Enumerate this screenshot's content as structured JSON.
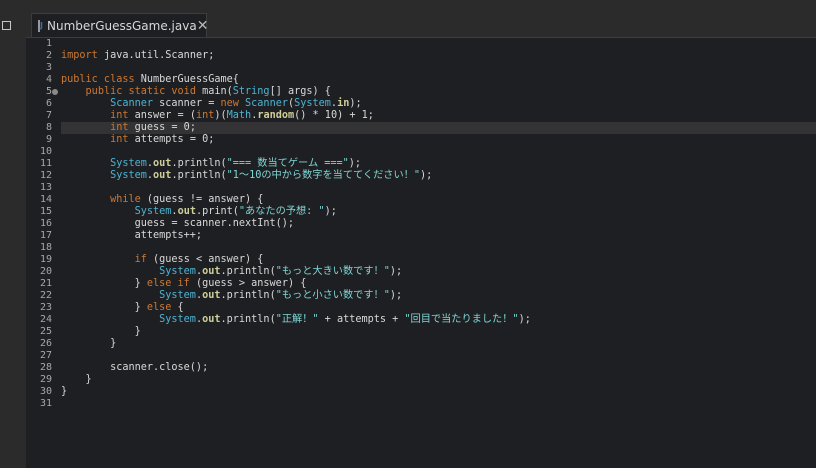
{
  "tab": {
    "title": "NumberGuessGame.java",
    "icon": "J",
    "close": "✕"
  },
  "colors": {
    "background": "#1e1f22",
    "keyword": "#cc7832",
    "type": "#4eb3d3",
    "string": "#7fd6d6",
    "field": "#cfcf9b"
  },
  "editor": {
    "highlighted_line": 8,
    "lines": [
      {
        "n": "1",
        "html": ""
      },
      {
        "n": "2",
        "html": "<span class='kw'>import</span> java.util.Scanner;"
      },
      {
        "n": "3",
        "html": ""
      },
      {
        "n": "4",
        "html": "<span class='kw'>public class</span> NumberGuessGame{"
      },
      {
        "n": "5",
        "html": "    <span class='kw'>public static void</span> main(<span class='ty'>String</span>[] args) {"
      },
      {
        "n": "6",
        "html": "        <span class='ty'>Scanner</span> scanner = <span class='kw'>new</span> <span class='ty'>Scanner</span>(<span class='ty'>System</span>.<span class='fld'>in</span>);"
      },
      {
        "n": "7",
        "html": "        <span class='kw'>int</span> answer = (<span class='kw'>int</span>)(<span class='ty'>Math</span>.<span class='fld'>random</span>() * 10) + 1;"
      },
      {
        "n": "8",
        "html": "        <span class='kw'>int</span> guess = 0;"
      },
      {
        "n": "9",
        "html": "        <span class='kw'>int</span> attempts = 0;"
      },
      {
        "n": "10",
        "html": ""
      },
      {
        "n": "11",
        "html": "        <span class='ty'>System</span>.<span class='fld'>out</span>.println(<span class='str'>\"=== 数当てゲーム ===\"</span>);"
      },
      {
        "n": "12",
        "html": "        <span class='ty'>System</span>.<span class='fld'>out</span>.println(<span class='str'>\"1～10の中から数字を当ててください！\"</span>);"
      },
      {
        "n": "13",
        "html": ""
      },
      {
        "n": "14",
        "html": "        <span class='kw'>while</span> (guess != answer) {"
      },
      {
        "n": "15",
        "html": "            <span class='ty'>System</span>.<span class='fld'>out</span>.print(<span class='str'>\"あなたの予想: \"</span>);"
      },
      {
        "n": "16",
        "html": "            guess = scanner.nextInt();"
      },
      {
        "n": "17",
        "html": "            attempts++;"
      },
      {
        "n": "18",
        "html": ""
      },
      {
        "n": "19",
        "html": "            <span class='kw'>if</span> (guess &lt; answer) {"
      },
      {
        "n": "20",
        "html": "                <span class='ty'>System</span>.<span class='fld'>out</span>.println(<span class='str'>\"もっと大きい数です！\"</span>);"
      },
      {
        "n": "21",
        "html": "            } <span class='kw'>else if</span> (guess &gt; answer) {"
      },
      {
        "n": "22",
        "html": "                <span class='ty'>System</span>.<span class='fld'>out</span>.println(<span class='str'>\"もっと小さい数です！\"</span>);"
      },
      {
        "n": "23",
        "html": "            } <span class='kw'>else</span> {"
      },
      {
        "n": "24",
        "html": "                <span class='ty'>System</span>.<span class='fld'>out</span>.println(<span class='str'>\"正解！\"</span> + attempts + <span class='str'>\"回目で当たりました！\"</span>);"
      },
      {
        "n": "25",
        "html": "            }"
      },
      {
        "n": "26",
        "html": "        }"
      },
      {
        "n": "27",
        "html": ""
      },
      {
        "n": "28",
        "html": "        scanner.close();"
      },
      {
        "n": "29",
        "html": "    }"
      },
      {
        "n": "30",
        "html": "}"
      },
      {
        "n": "31",
        "html": ""
      }
    ]
  }
}
